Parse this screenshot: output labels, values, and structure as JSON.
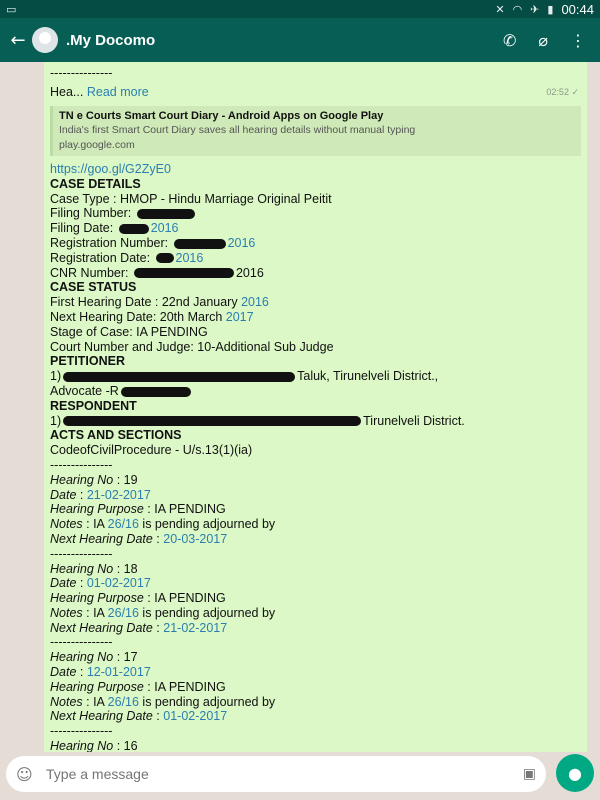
{
  "status_bar": {
    "time": "00:44",
    "icons": [
      "notification-icon",
      "mute-icon",
      "wifi-icon",
      "airplane-icon",
      "battery-icon"
    ]
  },
  "header": {
    "back_icon": "arrow-left-icon",
    "title": ".My Docomo",
    "actions": [
      "phone-icon",
      "attachment-icon",
      "more-icon"
    ]
  },
  "message": {
    "top_truncated": "---------------",
    "hea_prefix": "Hea...",
    "read_more": "Read more",
    "time": "02:52",
    "preview": {
      "title": "TN e Courts Smart Court Diary - Android Apps on Google Play",
      "desc": "India's first Smart Court Diary saves all hearing details without manual typing",
      "url": "play.google.com"
    },
    "short_link": "https://goo.gl/G2ZyE0",
    "case_details_heading": "CASE DETAILS",
    "case_type": "Case Type :  HMOP - Hindu Marriage Original Peitit",
    "filing_number_label": "Filing Number: ",
    "filing_date_label": "Filing Date: ",
    "filing_date_year": "2016",
    "registration_number_label": "Registration Number: ",
    "registration_number_year": "2016",
    "registration_date_label": "Registration Date: ",
    "registration_date_year": "2016",
    "cnr_label": "CNR Number: ",
    "cnr_suffix": "2016",
    "case_status_heading": "CASE STATUS",
    "first_hearing_label": "First Hearing Date : 22nd January ",
    "first_hearing_year": "2016",
    "next_hearing_label": "Next Hearing Date: 20th March ",
    "next_hearing_year": "2017",
    "stage": "Stage of Case: IA PENDING",
    "court": "Court Number and Judge: 10-Additional Sub Judge",
    "petitioner_heading": "PETITIONER",
    "petitioner_prefix": "1)",
    "petitioner_suffix": "Taluk, Tirunelveli District.,",
    "advocate_label": "Advocate -R",
    "respondent_heading": "RESPONDENT",
    "respondent_prefix": "1)",
    "respondent_suffix": "Tirunelveli District.",
    "acts_heading": "ACTS AND SECTIONS",
    "act": "CodeofCivilProcedure - U/s.13(1)(ia)",
    "separator": "---------------",
    "hearings": [
      {
        "no_label": "Hearing No",
        "no": " : 19",
        "date_label": "Date",
        "date_sep": " : ",
        "date": "21-02-2017",
        "purpose_label": "Hearing Purpose",
        "purpose": " :  IA PENDING",
        "notes_label": "Notes",
        "notes_pre": " : IA ",
        "notes_ref": "26/16",
        "notes_post": " is pending adjourned by",
        "next_label": "Next Hearing Date",
        "next_sep": " : ",
        "next": "20-03-2017"
      },
      {
        "no_label": "Hearing No",
        "no": " : 18",
        "date_label": "Date",
        "date_sep": " : ",
        "date": "01-02-2017",
        "purpose_label": "Hearing Purpose",
        "purpose": " :  IA PENDING",
        "notes_label": "Notes",
        "notes_pre": " : IA ",
        "notes_ref": "26/16",
        "notes_post": " is pending adjourned by",
        "next_label": "Next Hearing Date",
        "next_sep": " : ",
        "next": "21-02-2017"
      },
      {
        "no_label": "Hearing No",
        "no": " : 17",
        "date_label": "Date",
        "date_sep": " : ",
        "date": "12-01-2017",
        "purpose_label": "Hearing Purpose",
        "purpose": " :  IA PENDING",
        "notes_label": "Notes",
        "notes_pre": " : IA ",
        "notes_ref": "26/16",
        "notes_post": " is pending   adjourned by",
        "next_label": "Next Hearing Date",
        "next_sep": " : ",
        "next": "01-02-2017"
      }
    ],
    "last_hearing_label": "Hearing No",
    "last_hearing_no": " : 16"
  },
  "input": {
    "placeholder": "Type a message",
    "emoji_icon": "emoji-icon",
    "camera_icon": "camera-icon",
    "mic_icon": "mic-icon"
  },
  "colors": {
    "app_bar": "#075e54",
    "bubble": "#dcf8c6",
    "link": "#2a7fb0",
    "mic": "#00a884"
  }
}
